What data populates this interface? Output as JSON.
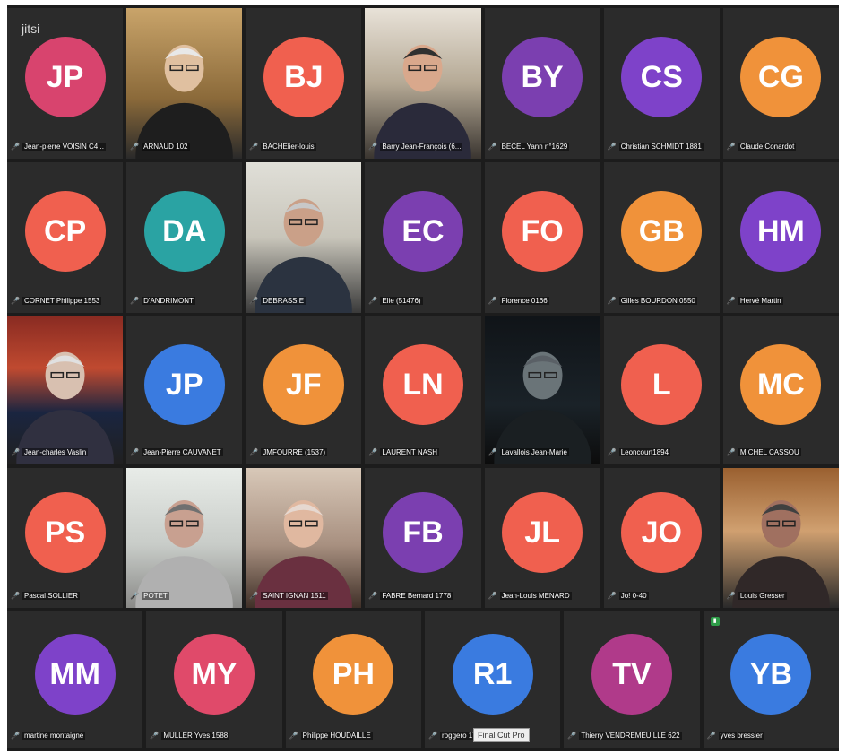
{
  "app": {
    "logo": "jitsi",
    "tooltip": "Final Cut Pro"
  },
  "rows": [
    [
      {
        "initials": "JP",
        "name": "Jean-pierre VOISIN C4...",
        "color": "#d8446e"
      },
      {
        "initials": "",
        "name": "ARNAUD 102",
        "video": "photo-a"
      },
      {
        "initials": "BJ",
        "name": "BACHElier-louis",
        "color": "#f0604f"
      },
      {
        "initials": "",
        "name": "Barry Jean-François (6...",
        "video": "photo-b"
      },
      {
        "initials": "BY",
        "name": "BECEL Yann n°1629",
        "color": "#7b3fb0"
      },
      {
        "initials": "CS",
        "name": "Christian SCHMIDT 1881",
        "color": "#7e42c9"
      },
      {
        "initials": "CG",
        "name": "Claude Conardot",
        "color": "#f0923a"
      }
    ],
    [
      {
        "initials": "CP",
        "name": "CORNET Philippe 1553",
        "color": "#f0604f"
      },
      {
        "initials": "DA",
        "name": "D'ANDRIMONT",
        "color": "#2aa3a3"
      },
      {
        "initials": "",
        "name": "DEBRASSIE",
        "video": "photo-c"
      },
      {
        "initials": "EC",
        "name": "Elie (51476)",
        "color": "#7b3fb0"
      },
      {
        "initials": "FO",
        "name": "Florence 0166",
        "color": "#f0604f"
      },
      {
        "initials": "GB",
        "name": "Gilles BOURDON 0550",
        "color": "#f0923a"
      },
      {
        "initials": "HM",
        "name": "Hervé Martin",
        "color": "#7e42c9"
      }
    ],
    [
      {
        "initials": "",
        "name": "Jean-charles Vaslin",
        "video": "photo-d",
        "active": true
      },
      {
        "initials": "JP",
        "name": "Jean-Pierre CAUVANET",
        "color": "#3a7be0"
      },
      {
        "initials": "JF",
        "name": "JMFOURRE (1537)",
        "color": "#f0923a"
      },
      {
        "initials": "LN",
        "name": "LAURENT NASH",
        "color": "#f0604f"
      },
      {
        "initials": "",
        "name": "Lavallois Jean-Marie",
        "video": "photo-e"
      },
      {
        "initials": "L",
        "name": "Leoncourt1894",
        "color": "#f0604f"
      },
      {
        "initials": "MC",
        "name": "MICHEL CASSOU",
        "color": "#f0923a"
      }
    ],
    [
      {
        "initials": "PS",
        "name": "Pascal SOLLIER",
        "color": "#f0604f"
      },
      {
        "initials": "",
        "name": "POTET",
        "video": "photo-f"
      },
      {
        "initials": "",
        "name": "SAINT IGNAN 1511",
        "video": "photo-g"
      },
      {
        "initials": "FB",
        "name": "FABRE Bernard 1778",
        "color": "#7b3fb0"
      },
      {
        "initials": "JL",
        "name": "Jean-Louis MENARD",
        "color": "#f0604f"
      },
      {
        "initials": "JO",
        "name": "Jo! 0-40",
        "color": "#f0604f"
      },
      {
        "initials": "",
        "name": "Louis Gresser",
        "video": "photo-h"
      }
    ],
    [
      {
        "initials": "MM",
        "name": "martine montaigne",
        "color": "#7e42c9"
      },
      {
        "initials": "MY",
        "name": "MULLER Yves 1588",
        "color": "#e04a6a"
      },
      {
        "initials": "PH",
        "name": "Philippe HOUDAILLE",
        "color": "#f0923a"
      },
      {
        "initials": "R1",
        "name": "roggero 17",
        "color": "#3a7be0"
      },
      {
        "initials": "TV",
        "name": "Thierry VENDREMEUILLE 622",
        "color": "#b03a8a"
      },
      {
        "initials": "YB",
        "name": "yves bressier",
        "color": "#3a7be0"
      }
    ]
  ],
  "mic_icon": "🎙"
}
